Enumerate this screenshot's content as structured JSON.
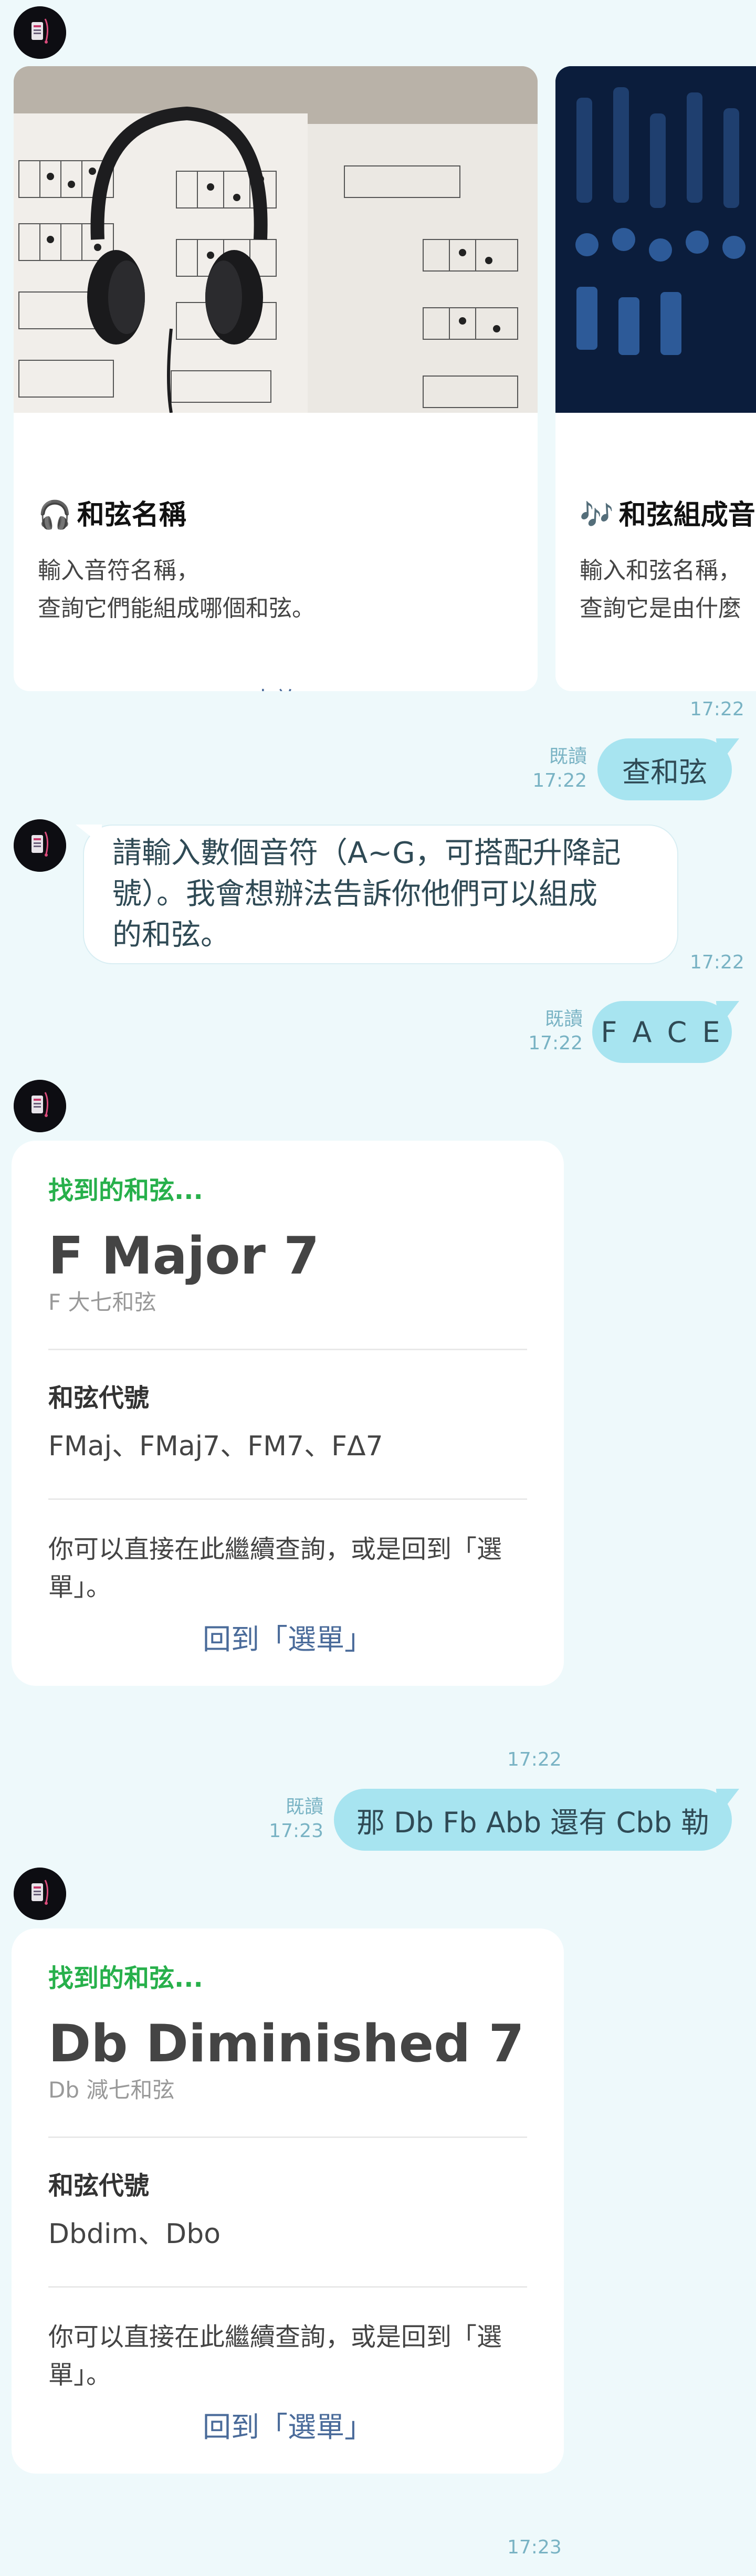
{
  "carousel": {
    "cards": [
      {
        "emoji": "🎧",
        "title": "和弦名稱",
        "desc": [
          "輸入音符名稱，",
          "查詢它們能組成哪個和弦。"
        ],
        "button": "查詢"
      },
      {
        "emoji": "🎶",
        "title": "和弦組成音",
        "desc": [
          "輸入和弦名稱，",
          "查詢它是由什麼"
        ]
      }
    ],
    "time": "17:22"
  },
  "messages": {
    "m1": {
      "text": "查和弦",
      "read": "既讀",
      "time": "17:22"
    },
    "m2": {
      "lines": [
        "請輸入數個音符（A~G，可搭配升降記",
        "號）。我會想辦法告訴你他們可以組成",
        "的和弦。"
      ],
      "time": "17:22"
    },
    "m3": {
      "text": "F A C E",
      "read": "既讀",
      "time": "17:22"
    },
    "m5": {
      "text": "那 Db Fb Abb 還有 Cbb 勒",
      "read": "既讀",
      "time": "17:23"
    }
  },
  "results": [
    {
      "found": "找到的和弦...",
      "name": "F Major 7",
      "sub": "F 大七和弦",
      "symbol_label": "和弦代號",
      "symbols": "FMaj、FMaj7、FM7、FΔ7",
      "note": [
        "你可以直接在此繼續查詢，或是回到「選",
        "單」。"
      ],
      "back": "回到「選單」",
      "time": "17:22"
    },
    {
      "found": "找到的和弦...",
      "name": "Db Diminished 7",
      "sub": "Db 減七和弦",
      "symbol_label": "和弦代號",
      "symbols": "Dbdim、Dbo",
      "note": [
        "你可以直接在此繼續查詢，或是回到「選",
        "單」。"
      ],
      "back": "回到「選單」",
      "time": "17:23"
    }
  ],
  "colors": {
    "background": "#eef9fb",
    "outgoing_bubble": "#a7e4f0",
    "found_label": "#27b04b",
    "link": "#4a6b9a",
    "meta": "#79b3c4"
  }
}
